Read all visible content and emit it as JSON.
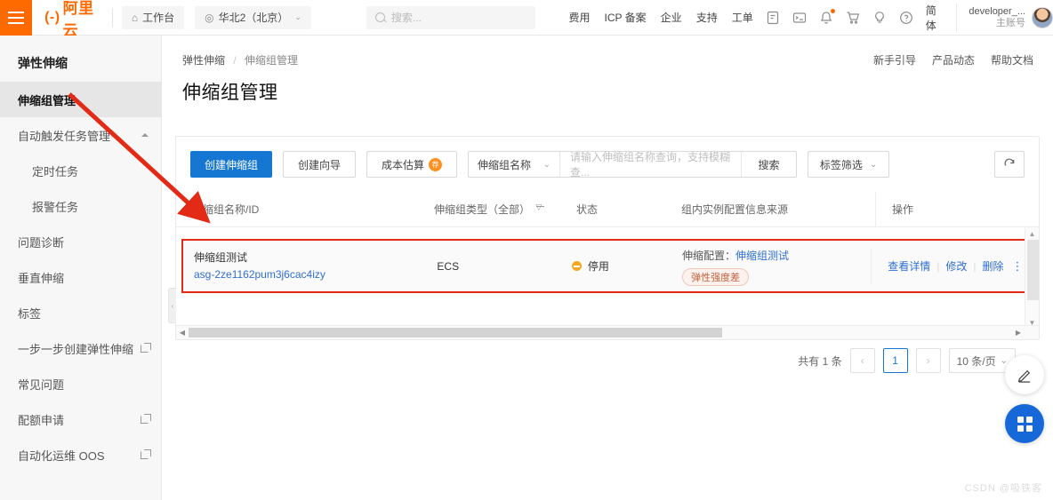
{
  "topbar": {
    "menu_icon": "hamburger-icon",
    "logo_text": "阿里云",
    "workbench": "工作台",
    "workbench_icon": "home-icon",
    "region": "华北2（北京）",
    "region_icon": "location-icon",
    "search_placeholder": "搜索...",
    "nav": [
      {
        "label": "费用"
      },
      {
        "label": "ICP 备案"
      },
      {
        "label": "企业"
      },
      {
        "label": "支持"
      },
      {
        "label": "工单"
      }
    ],
    "icons": [
      {
        "name": "app-icon"
      },
      {
        "name": "terminal-icon"
      },
      {
        "name": "bell-icon",
        "badge": true
      },
      {
        "name": "cart-icon"
      },
      {
        "name": "bulb-icon"
      },
      {
        "name": "help-icon"
      }
    ],
    "language": "简体",
    "user_name": "developer_...",
    "user_role": "主账号",
    "avatar_icon": "user-avatar"
  },
  "sidebar": {
    "title": "弹性伸缩",
    "items": [
      {
        "label": "伸缩组管理",
        "active": true,
        "external": false,
        "sub": false,
        "collapse": false
      },
      {
        "label": "自动触发任务管理",
        "active": false,
        "external": false,
        "sub": false,
        "collapse": true
      },
      {
        "label": "定时任务",
        "active": false,
        "external": false,
        "sub": true,
        "collapse": false
      },
      {
        "label": "报警任务",
        "active": false,
        "external": false,
        "sub": true,
        "collapse": false
      },
      {
        "label": "问题诊断",
        "active": false,
        "external": false,
        "sub": false,
        "collapse": false
      },
      {
        "label": "垂直伸缩",
        "active": false,
        "external": false,
        "sub": false,
        "collapse": false
      },
      {
        "label": "标签",
        "active": false,
        "external": false,
        "sub": false,
        "collapse": false
      },
      {
        "label": "一步一步创建弹性伸缩",
        "active": false,
        "external": true,
        "sub": false,
        "collapse": false
      },
      {
        "label": "常见问题",
        "active": false,
        "external": false,
        "sub": false,
        "collapse": false
      },
      {
        "label": "配额申请",
        "active": false,
        "external": true,
        "sub": false,
        "collapse": false
      },
      {
        "label": "自动化运维 OOS",
        "active": false,
        "external": true,
        "sub": false,
        "collapse": false
      }
    ]
  },
  "breadcrumb": {
    "root": "弹性伸缩",
    "current": "伸缩组管理"
  },
  "header_links": [
    {
      "label": "新手引导"
    },
    {
      "label": "产品动态"
    },
    {
      "label": "帮助文档"
    }
  ],
  "page_title": "伸缩组管理",
  "toolbar": {
    "create_group": "创建伸缩组",
    "create_wizard": "创建向导",
    "cost_estimate": "成本估算",
    "cost_badge": "荐",
    "filter_field": "伸缩组名称",
    "search_placeholder": "请输入伸缩组名称查询，支持模糊查...",
    "search_button": "搜索",
    "tag_filter": "标签筛选",
    "refresh_icon": "refresh-icon"
  },
  "table": {
    "columns": [
      {
        "label": "伸缩组名称/ID",
        "filter": false
      },
      {
        "label": "伸缩组类型（全部）",
        "filter": true
      },
      {
        "label": "状态",
        "filter": false
      },
      {
        "label": "组内实例配置信息来源",
        "filter": false
      },
      {
        "label": "操作",
        "filter": false
      }
    ],
    "rows": [
      {
        "name": "伸缩组测试",
        "id": "asg-2ze1162pum3j6cac4izy",
        "type": "ECS",
        "status": "停用",
        "status_icon": "pause-status-icon",
        "source_label": "伸缩配置：",
        "source_link": "伸缩组测试",
        "tag": "弹性强度差",
        "actions": [
          {
            "label": "查看详情"
          },
          {
            "label": "修改"
          },
          {
            "label": "删除"
          }
        ],
        "more_icon": "more-vertical-icon"
      }
    ]
  },
  "pagination": {
    "total_text": "共有 1 条",
    "prev": "‹",
    "next": "›",
    "current_page": "1",
    "page_size": "10 条/页"
  },
  "floating": {
    "edit_icon": "pencil-icon",
    "grid_icon": "apps-grid-icon"
  },
  "watermark": "CSDN @吸铁客",
  "colors": {
    "brand_orange": "#ff6a00",
    "primary_blue": "#1677d2",
    "link_blue": "#2f6fd0",
    "annotation_red": "#e32a16",
    "status_orange": "#f5a623"
  }
}
